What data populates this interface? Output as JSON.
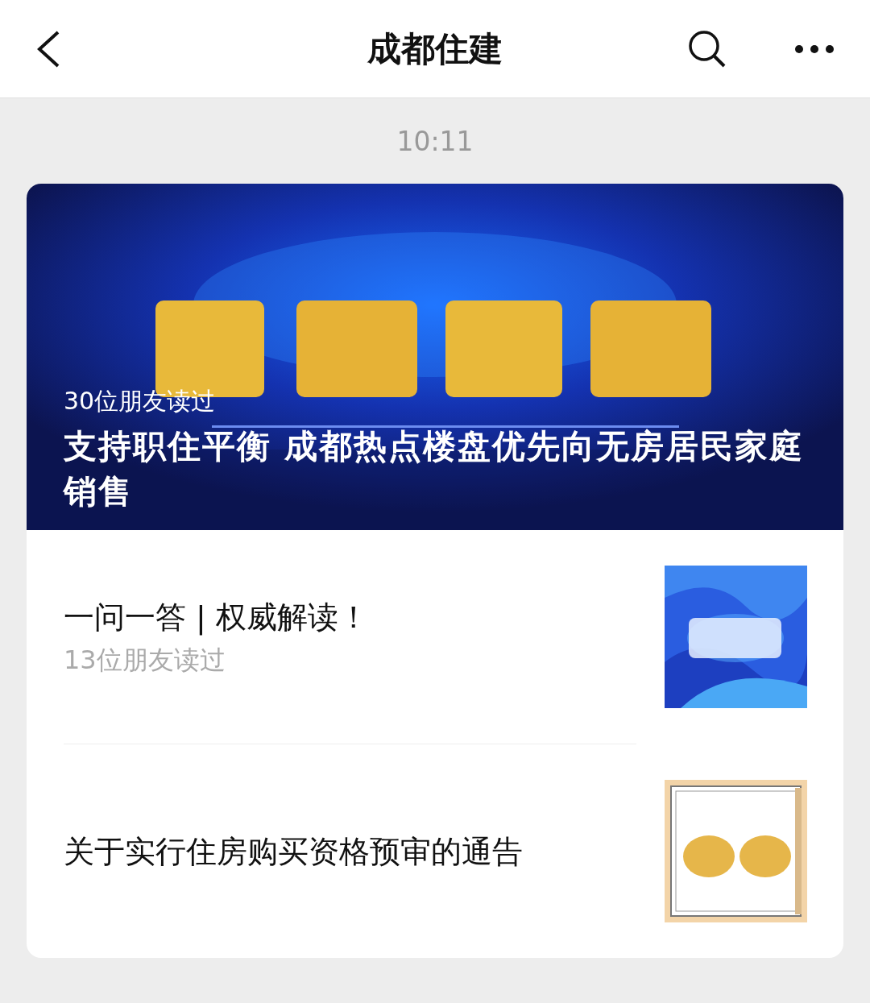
{
  "header": {
    "title": "成都住建"
  },
  "time": "10:11",
  "cover_article": {
    "read_count": "30位朋友读过",
    "title": "支持职住平衡 成都热点楼盘优先向无房居民家庭销售"
  },
  "articles": [
    {
      "title": "一问一答 | 权威解读！",
      "read_count": "13位朋友读过"
    },
    {
      "title": "关于实行住房购买资格预审的通告"
    }
  ]
}
